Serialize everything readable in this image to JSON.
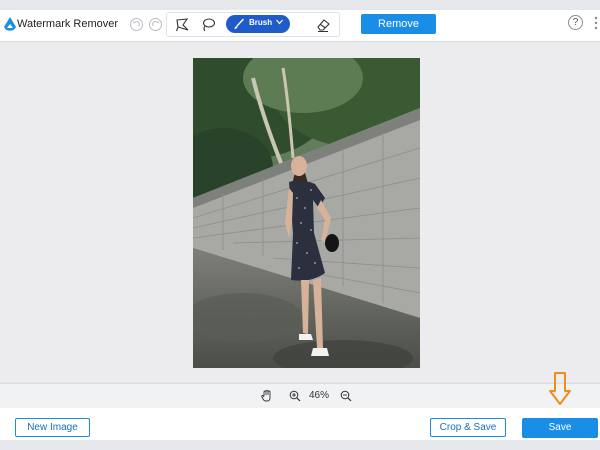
{
  "app": {
    "title": "Watermark Remover"
  },
  "toolbar": {
    "brush_label": "Brush",
    "remove_label": "Remove",
    "help_label": "?"
  },
  "zoom": {
    "level": "46%"
  },
  "footer": {
    "new_image_label": "New Image",
    "crop_save_label": "Crop & Save",
    "save_label": "Save"
  },
  "colors": {
    "accent": "#1a8ee6",
    "brush_active": "#1f5bc9",
    "annotation_arrow": "#f08c1e"
  }
}
